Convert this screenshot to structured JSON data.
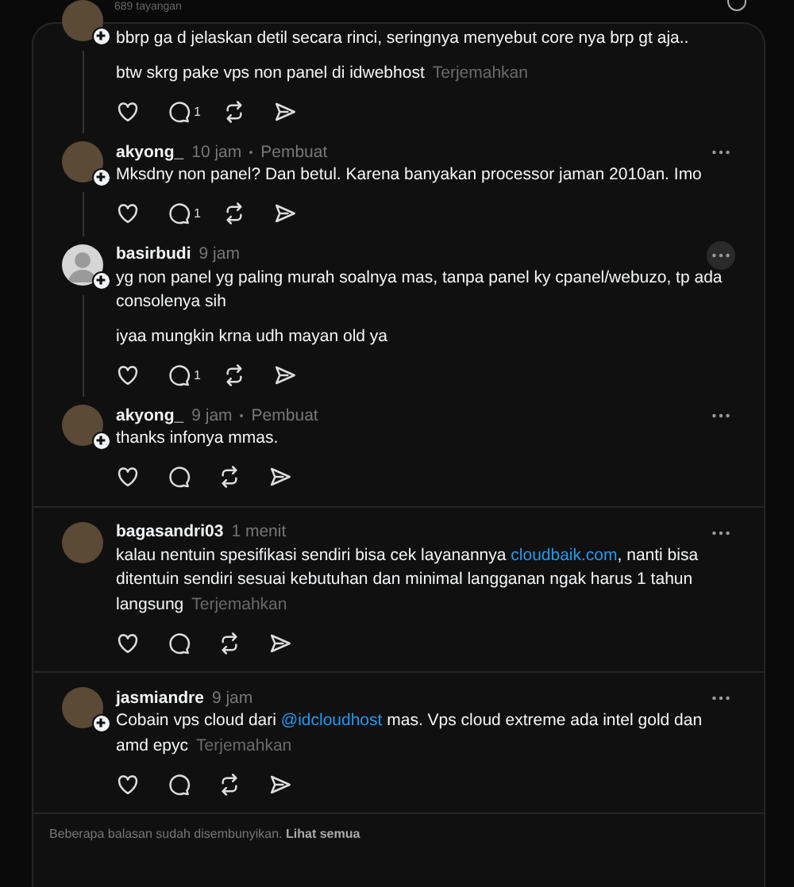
{
  "views": "689 tayangan",
  "groups": [
    {
      "posts": [
        {
          "avatar": {
            "kind": "photo",
            "follow_badge": true
          },
          "paragraphs": [
            [
              {
                "kind": "text",
                "text": "bbrp ga d jelaskan detil secara rinci, seringnya menyebut core nya brp gt aja.."
              }
            ],
            [
              {
                "kind": "text",
                "text": "btw skrg pake vps non panel di idwebhost"
              }
            ]
          ],
          "translate": "Terjemahkan",
          "reply_count": "1"
        },
        {
          "username": "akyong_",
          "time": "10 jam",
          "creator_label": "Pembuat",
          "avatar": {
            "kind": "photo",
            "follow_badge": true
          },
          "more_hovered": false,
          "paragraphs": [
            [
              {
                "kind": "text",
                "text": "Mksdny non panel? Dan betul. Karena banyakan processor jaman 2010an. Imo"
              }
            ]
          ],
          "reply_count": "1"
        },
        {
          "username": "basirbudi",
          "time": "9 jam",
          "avatar": {
            "kind": "default",
            "follow_badge": true
          },
          "more_hovered": true,
          "paragraphs": [
            [
              {
                "kind": "text",
                "text": "yg non panel yg paling murah soalnya mas, tanpa panel ky cpanel/webuzo, tp ada consolenya sih"
              }
            ],
            [
              {
                "kind": "text",
                "text": "iyaa mungkin krna udh mayan old ya"
              }
            ]
          ],
          "reply_count": "1"
        },
        {
          "username": "akyong_",
          "time": "9 jam",
          "creator_label": "Pembuat",
          "avatar": {
            "kind": "photo",
            "follow_badge": true
          },
          "more_hovered": false,
          "paragraphs": [
            [
              {
                "kind": "text",
                "text": "thanks infonya mmas."
              }
            ]
          ]
        }
      ]
    },
    {
      "posts": [
        {
          "username": "bagasandri03",
          "time": "1 menit",
          "avatar": {
            "kind": "photo",
            "follow_badge": false
          },
          "more_hovered": false,
          "paragraphs": [
            [
              {
                "kind": "text",
                "text": "kalau nentuin spesifikasi sendiri bisa cek layanannya "
              },
              {
                "kind": "link",
                "text": "cloudbaik.com"
              },
              {
                "kind": "text",
                "text": ", nanti bisa ditentuin sendiri sesuai kebutuhan dan minimal langganan ngak harus 1 tahun langsung"
              }
            ]
          ],
          "translate": "Terjemahkan"
        }
      ]
    },
    {
      "posts": [
        {
          "username": "jasmiandre",
          "time": "9 jam",
          "avatar": {
            "kind": "photo",
            "follow_badge": true
          },
          "more_hovered": false,
          "paragraphs": [
            [
              {
                "kind": "text",
                "text": "Cobain vps cloud dari "
              },
              {
                "kind": "link",
                "text": "@idcloudhost"
              },
              {
                "kind": "text",
                "text": " mas. Vps cloud extreme ada intel gold dan amd epyc"
              }
            ]
          ],
          "translate": "Terjemahkan"
        }
      ]
    }
  ],
  "footer": {
    "text": "Beberapa balasan sudah disembunyikan.",
    "link": "Lihat semua"
  }
}
